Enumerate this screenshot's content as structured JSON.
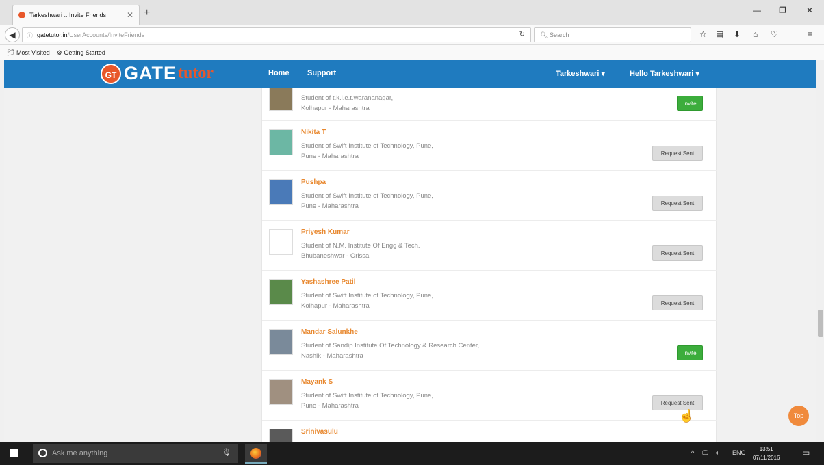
{
  "browser": {
    "tab_title": "Tarkeshwari :: Invite Friends",
    "url_host": "gatetutor.in",
    "url_path": "/UserAccounts/InviteFriends",
    "search_placeholder": "Search",
    "bookmarks": [
      "Most Visited",
      "Getting Started"
    ]
  },
  "site": {
    "logo_badge": "GT",
    "logo_gate": "GATE",
    "logo_tutor": "tutor",
    "menu": {
      "home": "Home",
      "support": "Support",
      "user": "Tarkeshwari",
      "greeting": "Hello Tarkeshwari"
    }
  },
  "people": [
    {
      "name": "",
      "line1": "Student of t.k.i.e.t.warananagar,",
      "line2": "Kolhapur - Maharashtra",
      "action": "Invite",
      "photo": true
    },
    {
      "name": "Nikita T",
      "line1": "Student of Swift Institute of Technology, Pune,",
      "line2": "Pune - Maharashtra",
      "action": "Request Sent",
      "photo": true
    },
    {
      "name": "Pushpa",
      "line1": "Student of Swift Institute of Technology, Pune,",
      "line2": "Pune - Maharashtra",
      "action": "Request Sent",
      "photo": true
    },
    {
      "name": "Priyesh Kumar",
      "line1": "Student of N.M. Institute Of Engg & Tech.",
      "line2": "Bhubaneshwar - Orissa",
      "action": "Request Sent",
      "photo": false
    },
    {
      "name": "Yashashree Patil",
      "line1": "Student of Swift Institute of Technology, Pune,",
      "line2": "Kolhapur - Maharashtra",
      "action": "Request Sent",
      "photo": true
    },
    {
      "name": "Mandar Salunkhe",
      "line1": "Student of Sandip Institute Of Technology & Research Center,",
      "line2": "Nashik - Maharashtra",
      "action": "Invite",
      "photo": true
    },
    {
      "name": "Mayank S",
      "line1": "Student of Swift Institute of Technology, Pune,",
      "line2": "Pune - Maharashtra",
      "action": "Request Sent",
      "photo": true
    },
    {
      "name": "Srinivasulu",
      "line1": "",
      "line2": "",
      "action": "",
      "photo": true
    }
  ],
  "top_button": "Top",
  "taskbar": {
    "search_placeholder": "Ask me anything",
    "lang": "ENG",
    "time": "13:51",
    "date": "07/11/2016"
  }
}
